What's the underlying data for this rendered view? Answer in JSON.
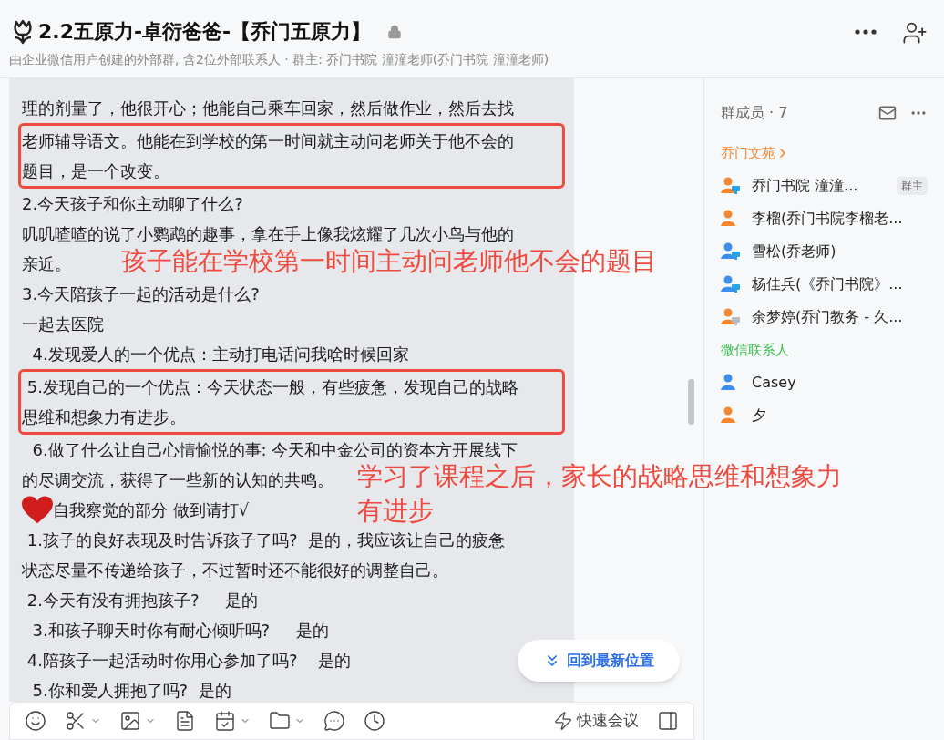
{
  "header": {
    "title": "2.2五原力-卓衍爸爸-【乔门五原力】",
    "subtitle": "由企业微信用户创建的外部群, 含2位外部联系人 · 群主: 乔门书院 潼潼老师(乔门书院 潼潼老师)"
  },
  "message": [
    {
      "kind": "text",
      "lines": [
        "理的剂量了，他很开心；他能自己乘车回家，然后做作业，然后去找"
      ]
    },
    {
      "kind": "boxed",
      "lines": [
        "老师辅导语文。他能在到学校的第一时间就主动问老师关于他不会的",
        "题目，是一个改变。"
      ]
    },
    {
      "kind": "text",
      "lines": [
        "2.今天孩子和你主动聊了什么?"
      ]
    },
    {
      "kind": "text",
      "lines": [
        "叽叽喳喳的说了小鹦鹉的趣事，拿在手上像我炫耀了几次小鸟与他的",
        "亲近。"
      ]
    },
    {
      "kind": "text",
      "lines": [
        "3.今天陪孩子一起的活动是什么?"
      ]
    },
    {
      "kind": "text",
      "lines": [
        "一起去医院"
      ]
    },
    {
      "kind": "text",
      "lines": [
        "  4.发现爱人的一个优点：主动打电话问我啥时候回家"
      ]
    },
    {
      "kind": "boxed",
      "lines": [
        " 5.发现自己的一个优点：今天状态一般，有些疲惫，发现自己的战略",
        "思维和想象力有进步。"
      ]
    },
    {
      "kind": "text",
      "lines": [
        "  6.做了什么让自己心情愉悦的事: 今天和中金公司的资本方开展线下",
        "的尽调交流，获得了一些新的认知的共鸣。"
      ]
    },
    {
      "kind": "heart",
      "lines": [
        "自我察觉的部分 做到请打√"
      ]
    },
    {
      "kind": "text",
      "lines": [
        " 1.孩子的良好表现及时告诉孩子了吗?  是的，我应该让自己的疲惫",
        "状态尽量不传递给孩子，不过暂时还不能很好的调整自己。"
      ]
    },
    {
      "kind": "text",
      "lines": [
        " 2.今天有没有拥抱孩子?     是的"
      ]
    },
    {
      "kind": "text",
      "lines": [
        "  3.和孩子聊天时你有耐心倾听吗?     是的"
      ]
    },
    {
      "kind": "text",
      "lines": [
        " 4.陪孩子一起活动时你用心参加了吗?    是的"
      ]
    },
    {
      "kind": "text",
      "lines": [
        "  5.你和爱人拥抱了吗?  是的"
      ]
    }
  ],
  "annotations": [
    "孩子能在学校第一时间主动问老师他不会的题目",
    "学习了课程之后，家长的战略思维和想象力有进步"
  ],
  "jump_button": "回到最新位置",
  "toolbar": {
    "meeting": "快速会议"
  },
  "members": {
    "title": "群成员 · 7",
    "groups": [
      {
        "name": "乔门文苑",
        "color": "#f5862e",
        "link": true,
        "items": [
          {
            "name": "乔门书院 潼潼...",
            "color": "#f5862e",
            "kind": "desktop-online",
            "badge": "群主"
          },
          {
            "name": "李榴(乔门书院李榴老...",
            "color": "#f5862e",
            "kind": "plain"
          },
          {
            "name": "雪松(乔老师)",
            "color": "#3d8fee",
            "kind": "desktop-online"
          },
          {
            "name": "杨佳兵(《乔门书院》...",
            "color": "#3d8fee",
            "kind": "desktop-online"
          },
          {
            "name": "余梦婷(乔门教务 - 久...",
            "color": "#f5862e",
            "kind": "desktop-offline"
          }
        ]
      },
      {
        "name": "微信联系人",
        "color": "#3cc051",
        "link": false,
        "items": [
          {
            "name": "Casey",
            "color": "#3d8fee",
            "kind": "plain"
          },
          {
            "name": "夕",
            "color": "#f5862e",
            "kind": "plain"
          }
        ]
      }
    ]
  }
}
